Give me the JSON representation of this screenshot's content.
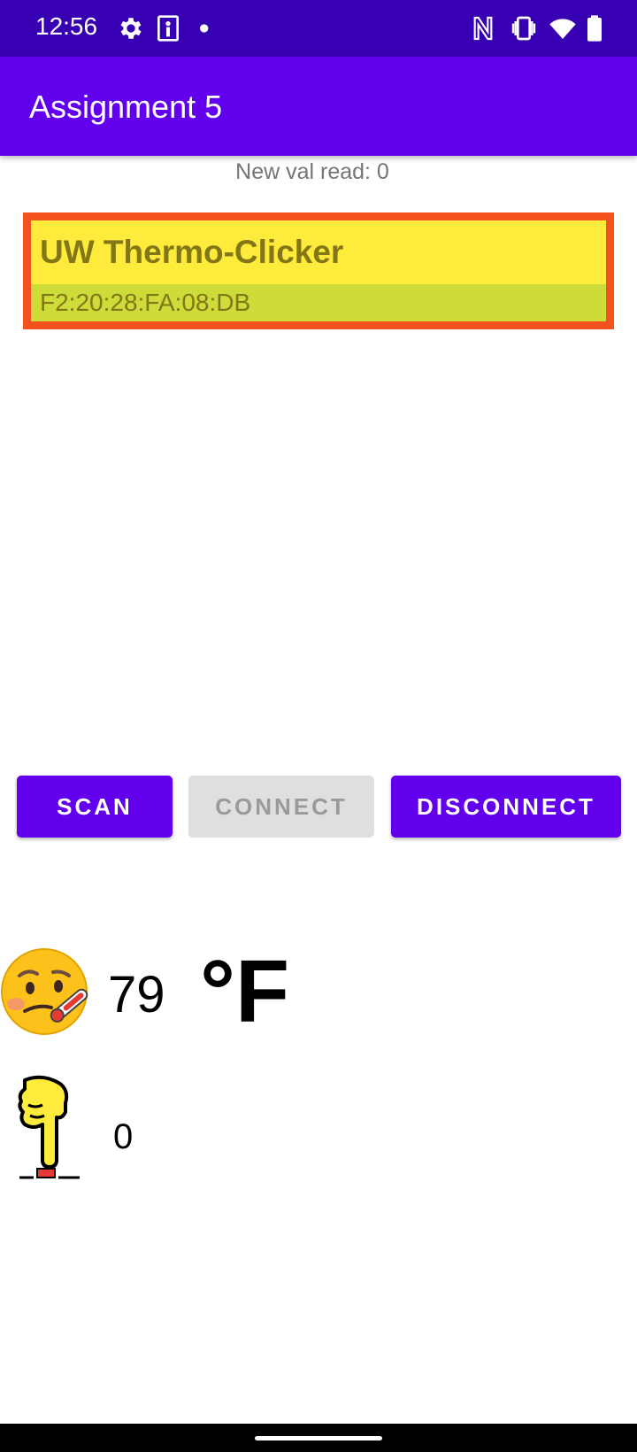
{
  "status_bar": {
    "time": "12:56",
    "icons_left": [
      "gear-icon",
      "portrait-icon",
      "dot-icon"
    ],
    "icons_right": [
      "nfc-icon",
      "vibrate-icon",
      "wifi-icon",
      "battery-icon"
    ]
  },
  "app_bar": {
    "title": "Assignment 5"
  },
  "status_text": "New val read: 0",
  "device": {
    "name": "UW Thermo-Clicker",
    "address": "F2:20:28:FA:08:DB"
  },
  "buttons": {
    "scan": "SCAN",
    "connect": "CONNECT",
    "disconnect": "DISCONNECT"
  },
  "temperature": {
    "value": "79",
    "unit": "°F",
    "icon": "thermometer-face-emoji"
  },
  "clicks": {
    "value": "0",
    "icon": "pointing-finger-button-icon"
  },
  "colors": {
    "status_bar": "#3700b3",
    "app_bar": "#6200ee",
    "card_border": "#f4511e",
    "card_name_bg": "#ffeb3b",
    "card_addr_bg": "#cddc39",
    "card_text": "#827717",
    "button_primary": "#6200ee",
    "button_disabled": "#dfdfdf"
  }
}
